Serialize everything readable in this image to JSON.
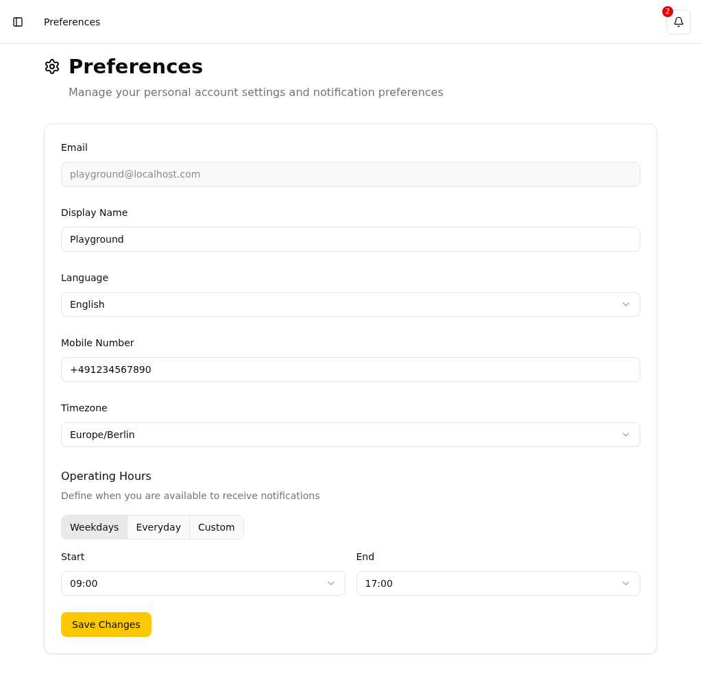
{
  "header": {
    "title": "Preferences",
    "notifications": {
      "count": "2"
    }
  },
  "page": {
    "title": "Preferences",
    "subtitle": "Manage your personal account settings and notification preferences"
  },
  "form": {
    "fields": [
      {
        "kind": "input",
        "label": "Email",
        "value": "playground@localhost.com",
        "disabled": true
      },
      {
        "kind": "input",
        "label": "Display Name",
        "value": "Playground",
        "disabled": false
      },
      {
        "kind": "select",
        "label": "Language",
        "value": "English",
        "disabled": false
      },
      {
        "kind": "input",
        "label": "Mobile Number",
        "value": "+491234567890",
        "disabled": false
      },
      {
        "kind": "select",
        "label": "Timezone",
        "value": "Europe/Berlin",
        "disabled": false
      }
    ],
    "operating_hours": {
      "title": "Operating Hours",
      "description": "Define when you are available to receive notifications",
      "options": [
        {
          "label": "Weekdays",
          "selected": true
        },
        {
          "label": "Everyday",
          "selected": false
        },
        {
          "label": "Custom",
          "selected": false
        }
      ],
      "times": [
        {
          "label": "Start",
          "value": "09:00"
        },
        {
          "label": "End",
          "value": "17:00"
        }
      ]
    },
    "save_button": "Save Changes"
  }
}
